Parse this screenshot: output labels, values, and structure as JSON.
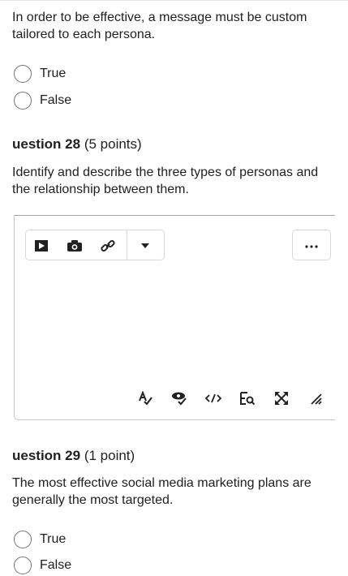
{
  "q27": {
    "prompt": "In order to be effective, a message must be custom tailored to each persona.",
    "options": [
      "True",
      "False"
    ]
  },
  "q28": {
    "number_label": "uestion 28",
    "points": "(5 points)",
    "prompt": "Identify and describe the three types of personas and the relationship between them.",
    "editor": {
      "toolbar_icons": [
        "insert-video-icon",
        "insert-image-icon",
        "insert-link-icon",
        "dropdown-caret-icon"
      ],
      "more_icon": "more-options-icon",
      "status_icons": [
        "spellcheck-icon",
        "accessibility-check-icon",
        "source-code-icon",
        "find-replace-icon",
        "fullscreen-icon",
        "resize-handle-icon"
      ]
    }
  },
  "q29": {
    "number_label": "uestion 29",
    "points": "(1 point)",
    "prompt": "The most effective social media marketing plans are generally the most targeted.",
    "options": [
      "True",
      "False"
    ]
  }
}
